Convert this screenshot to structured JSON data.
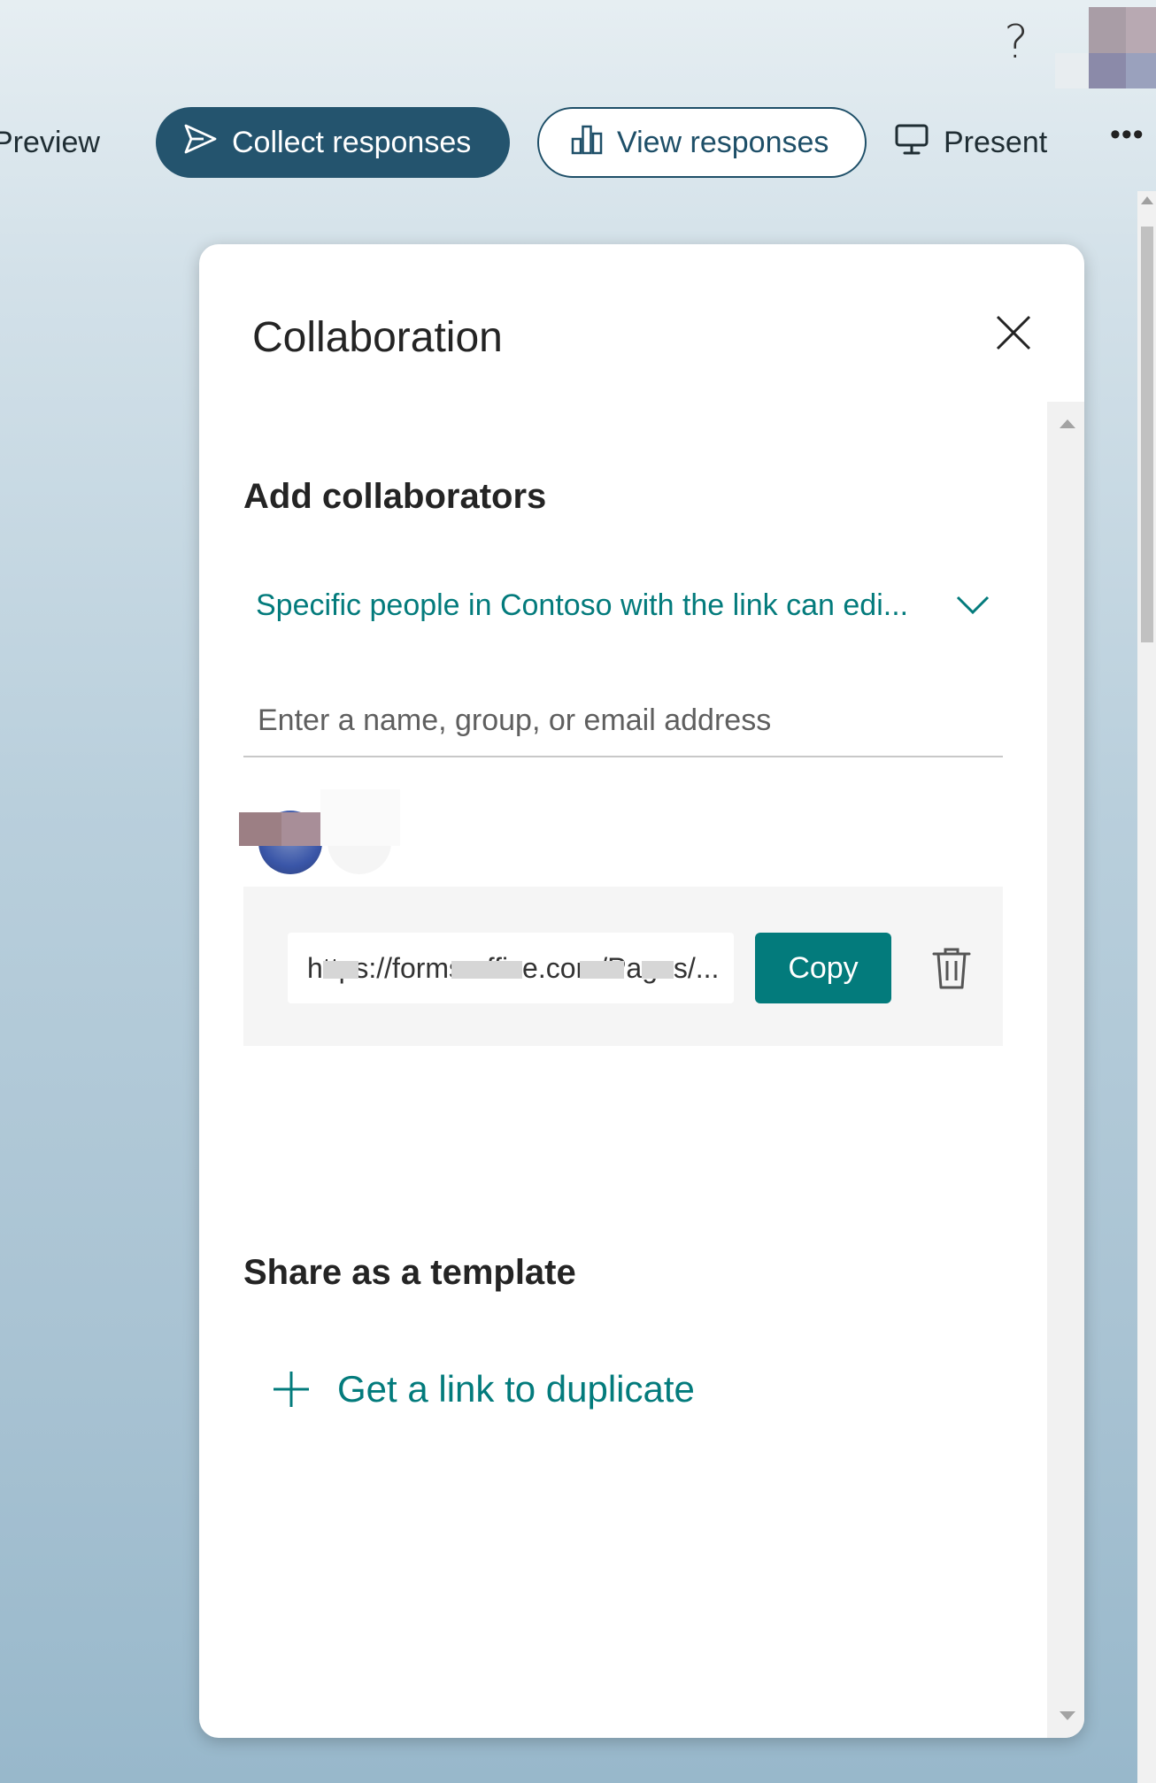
{
  "toolbar": {
    "help_glyph": "?",
    "preview_label": "Preview",
    "collect_label": "Collect responses",
    "view_label": "View responses",
    "present_label": "Present",
    "more_glyph": "•••"
  },
  "dialog": {
    "title": "Collaboration",
    "add_collaborators": {
      "heading": "Add collaborators",
      "permission_selected": "Specific people in Contoso with the link can edi...",
      "input_placeholder": "Enter a name, group, or email address",
      "link_value": "https://forms.office.com/Pages/...",
      "copy_label": "Copy"
    },
    "template": {
      "heading": "Share as a template",
      "duplicate_link_label": "Get a link to duplicate"
    }
  },
  "colors": {
    "accent_teal": "#037b7c",
    "collect_button": "#24546e",
    "view_border": "#1e4f68"
  }
}
